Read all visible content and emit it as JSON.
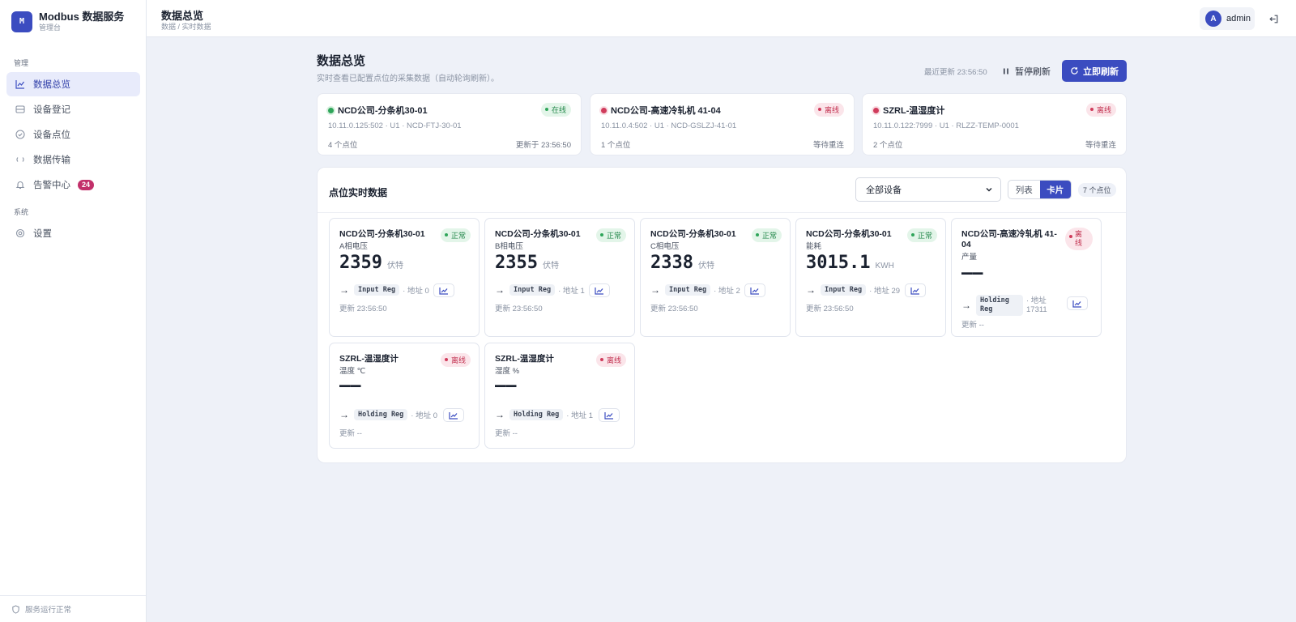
{
  "brand": {
    "logo": "M",
    "name": "Modbus 数据服务",
    "sub": "管理台"
  },
  "nav": {
    "section_manage": "管理",
    "section_system": "系统",
    "items": [
      {
        "label": "数据总览",
        "icon": "chart-line-icon",
        "active": true
      },
      {
        "label": "设备登记",
        "icon": "server-icon"
      },
      {
        "label": "设备点位",
        "icon": "check-circle-icon"
      },
      {
        "label": "数据传输",
        "icon": "sync-icon"
      },
      {
        "label": "告警中心",
        "icon": "bell-icon",
        "badge": "24"
      },
      {
        "label": "设置",
        "icon": "settings-icon"
      }
    ],
    "footer": "服务运行正常"
  },
  "topbar": {
    "title": "数据总览",
    "breadcrumb": "数据 / 实时数据",
    "avatar": "A",
    "user": "admin"
  },
  "header": {
    "title": "数据总览",
    "desc": "实时查看已配置点位的采集数据（自动轮询刷新）。",
    "last_update": "最近更新 23:56:50",
    "pause_label": "暂停刷新",
    "refresh_label": "立即刷新"
  },
  "devices": [
    {
      "name": "NCD公司-分条机30-01",
      "status": "在线",
      "online": true,
      "addr": "10.11.0.125:502 · U1 · NCD-FTJ-30-01",
      "points": "4 个点位",
      "right": "更新于 23:56:50"
    },
    {
      "name": "NCD公司-高速冷轧机 41-04",
      "status": "离线",
      "online": false,
      "addr": "10.11.0.4:502 · U1 · NCD-GSLZJ-41-01",
      "points": "1 个点位",
      "right": "等待重连"
    },
    {
      "name": "SZRL-温湿度计",
      "status": "离线",
      "online": false,
      "addr": "10.11.0.122:7999 · U1 · RLZZ-TEMP-0001",
      "points": "2 个点位",
      "right": "等待重连"
    }
  ],
  "panel": {
    "title": "点位实时数据",
    "filter_value": "全部设备",
    "view_list": "列表",
    "view_card": "卡片",
    "count": "7 个点位"
  },
  "points": [
    {
      "device": "NCD公司-分条机30-01",
      "name": "A相电压",
      "status": "正常",
      "ok": true,
      "value": "2359",
      "unit": "伏特",
      "reg": "Input Reg",
      "addr": "· 地址 0",
      "updated": "更新 23:56:50"
    },
    {
      "device": "NCD公司-分条机30-01",
      "name": "B相电压",
      "status": "正常",
      "ok": true,
      "value": "2355",
      "unit": "伏特",
      "reg": "Input Reg",
      "addr": "· 地址 1",
      "updated": "更新 23:56:50"
    },
    {
      "device": "NCD公司-分条机30-01",
      "name": "C相电压",
      "status": "正常",
      "ok": true,
      "value": "2338",
      "unit": "伏特",
      "reg": "Input Reg",
      "addr": "· 地址 2",
      "updated": "更新 23:56:50"
    },
    {
      "device": "NCD公司-分条机30-01",
      "name": "能耗",
      "status": "正常",
      "ok": true,
      "value": "3015.1",
      "unit": "KWH",
      "reg": "Input Reg",
      "addr": "· 地址 29",
      "updated": "更新 23:56:50"
    },
    {
      "device_line1": "NCD公司-高速冷轧机 41-",
      "device_line2": "04",
      "name": "产量",
      "status_line1": "离",
      "status_line2": "线",
      "ok": false,
      "value": "——",
      "unit": "",
      "reg_line1": "Holding",
      "reg_line2": "Reg",
      "addr_line1": "· 地址",
      "addr_line2": "17311",
      "updated": "更新 --"
    },
    {
      "device": "SZRL-温湿度计",
      "name": "温度 ℃",
      "status": "离线",
      "ok": false,
      "value": "——",
      "unit": "",
      "reg": "Holding Reg",
      "addr": "· 地址 0",
      "updated": "更新 --"
    },
    {
      "device": "SZRL-温湿度计",
      "name": "湿度 %",
      "status": "离线",
      "ok": false,
      "value": "——",
      "unit": "",
      "reg": "Holding Reg",
      "addr": "· 地址 1",
      "updated": "更新 --"
    }
  ],
  "colors": {
    "accent": "#3b4cc0",
    "online": "#2fa55a",
    "offline": "#d03c5c",
    "badge": "#c2306a"
  }
}
